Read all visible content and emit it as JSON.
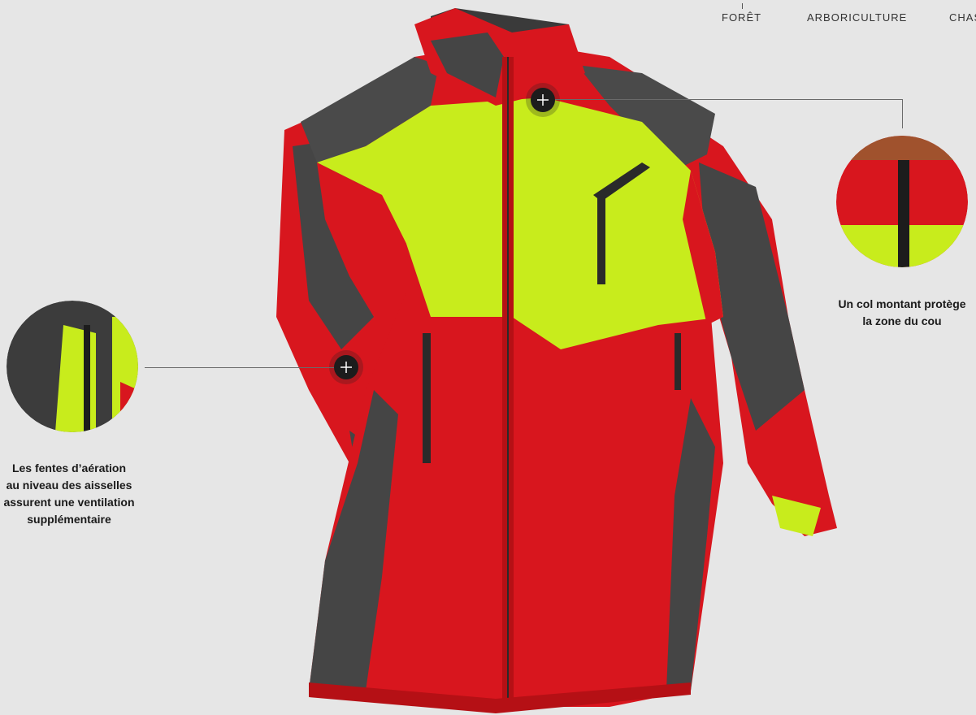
{
  "nav": {
    "items": [
      {
        "label": "FORÊT",
        "active": true
      },
      {
        "label": "ARBORICULTURE",
        "active": false
      },
      {
        "label": "CHASSE",
        "active": false
      }
    ]
  },
  "hotspots": {
    "collar": {
      "caption": "Un col montant protège\nla zone du cou"
    },
    "armpit": {
      "caption": "Les fentes d’aération\nau niveau des aisselles\nassurent une ventilation\nsupplémentaire"
    }
  },
  "colors": {
    "background": "#e6e6e6",
    "jacket_red": "#d8161e",
    "jacket_grey": "#454545",
    "jacket_yellow": "#c8ec1c",
    "hotspot": "#1c1c1c"
  }
}
